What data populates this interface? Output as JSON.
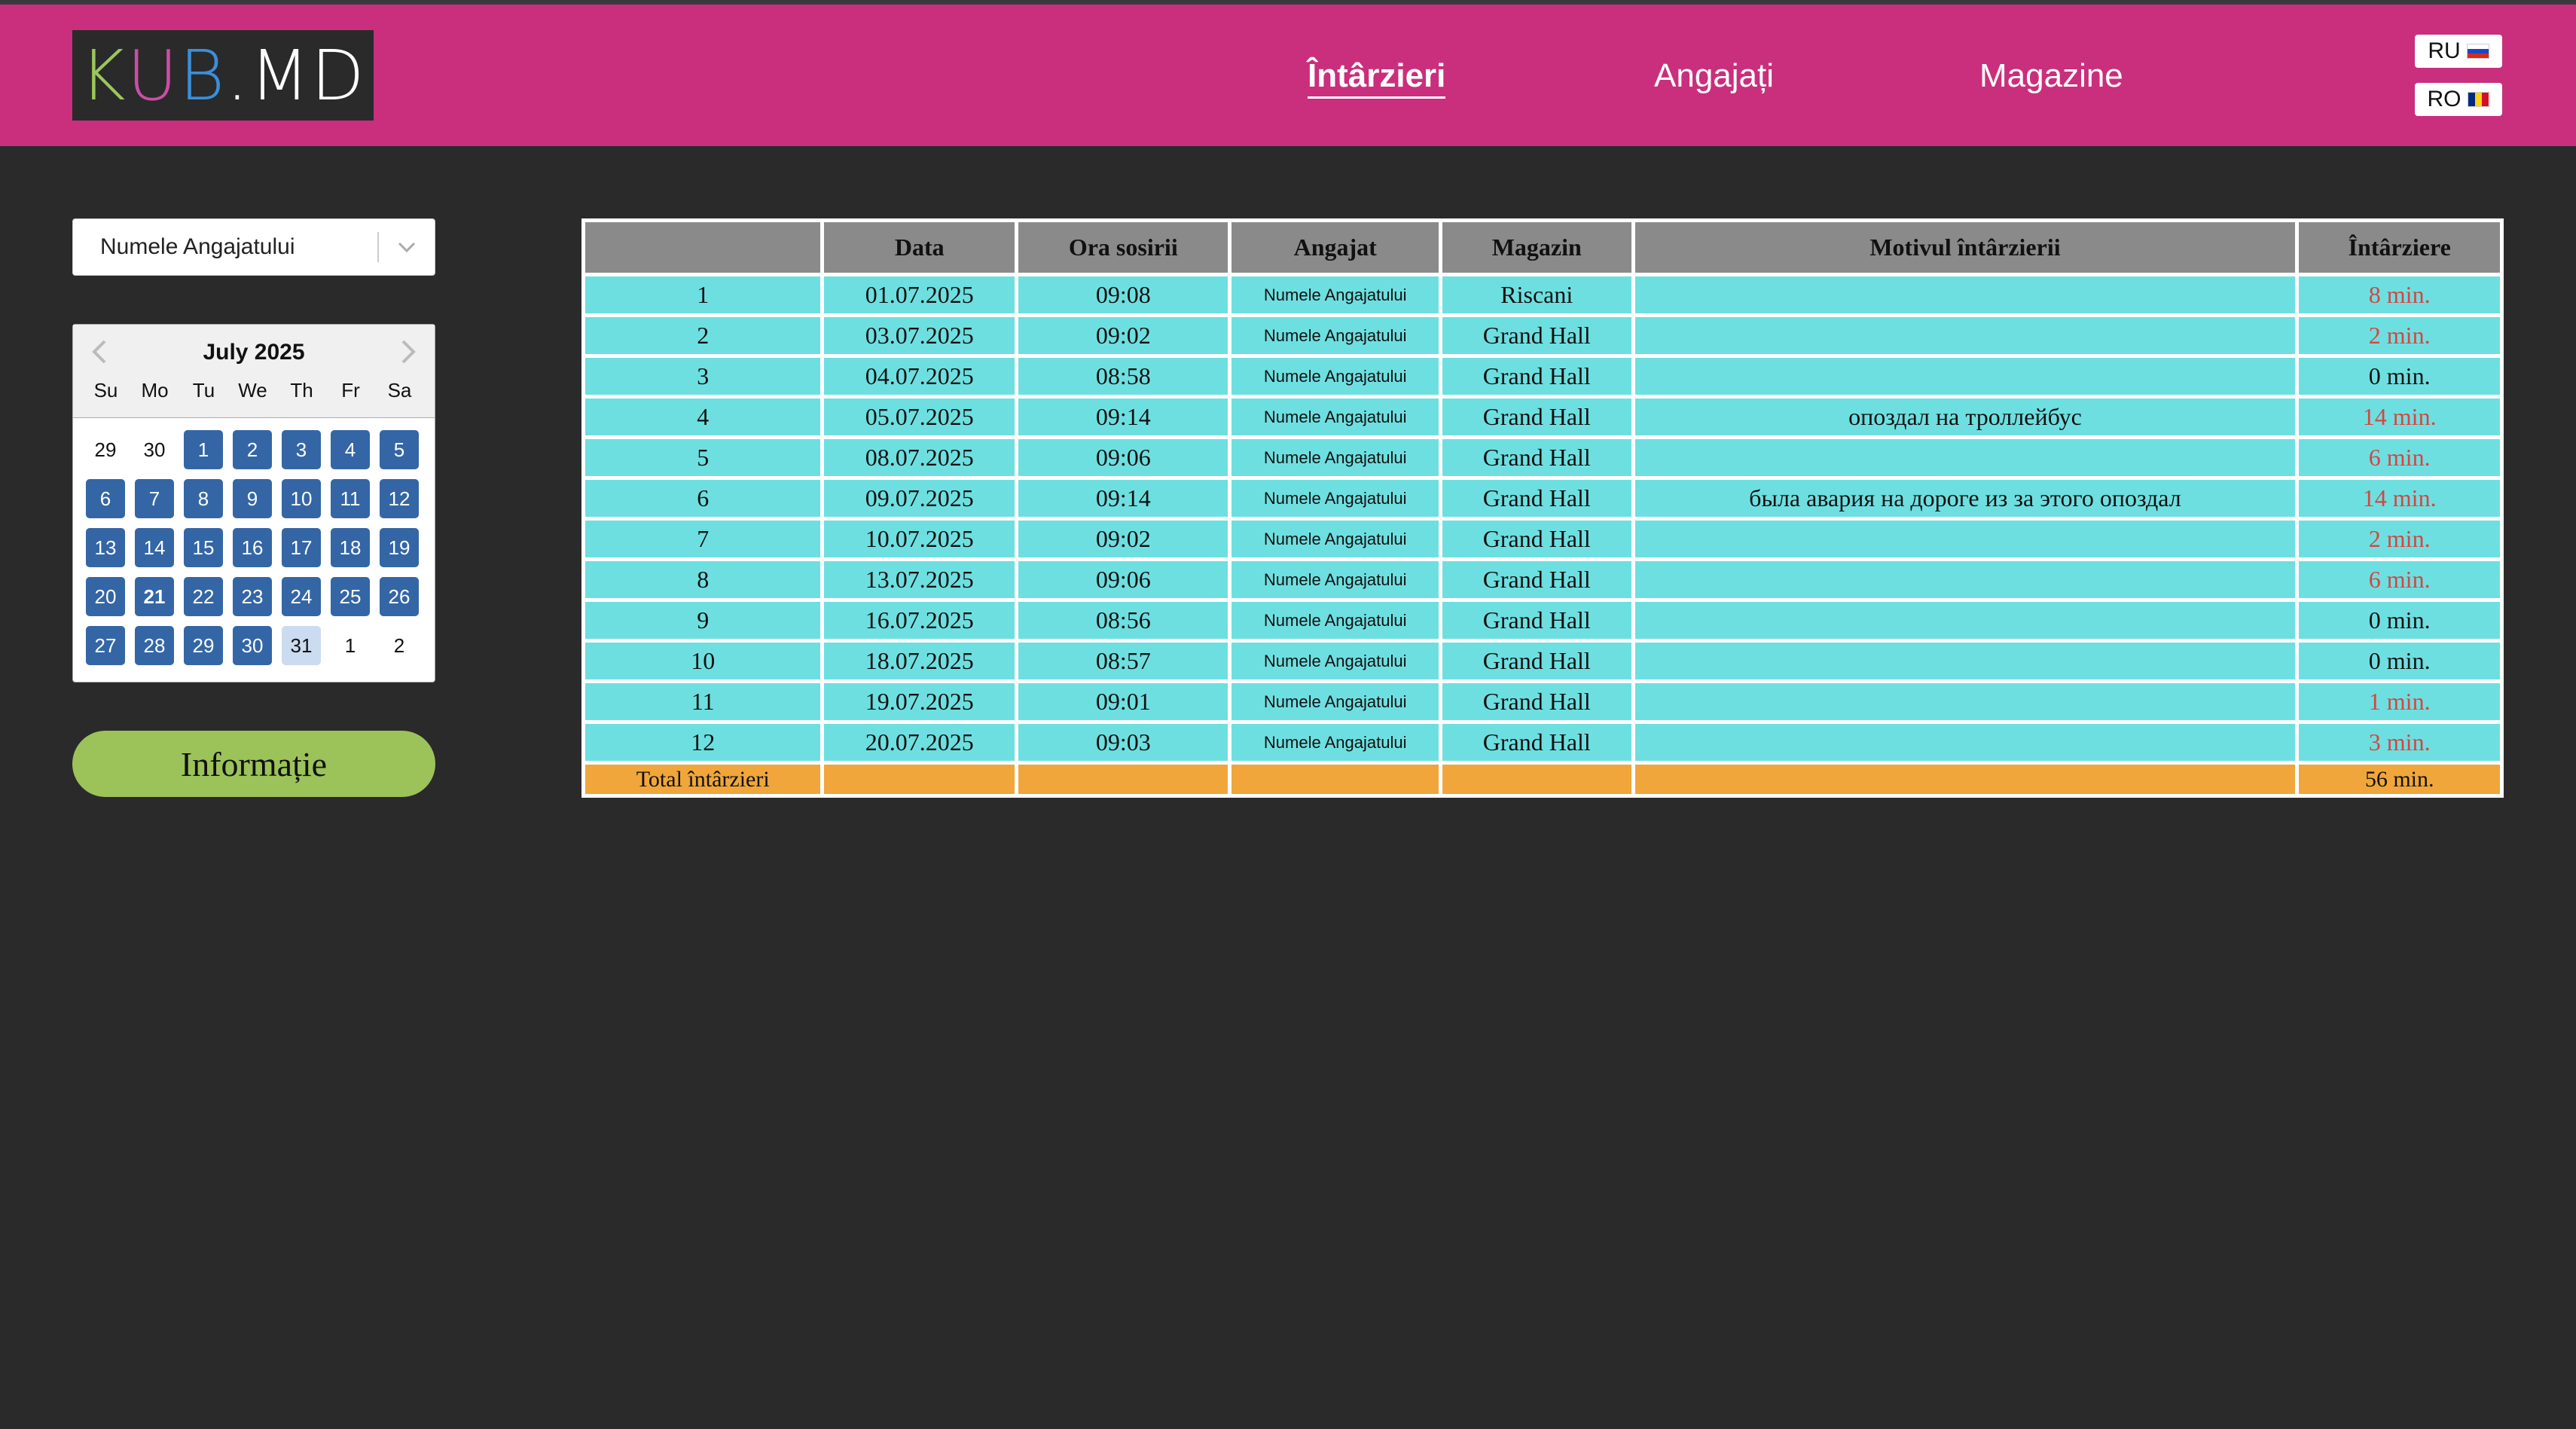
{
  "logo": {
    "letters": [
      "K",
      "U",
      "B",
      ".MD"
    ],
    "colors": [
      "#9bc65c",
      "#c94ea6",
      "#3b8fd9",
      "#ffffff"
    ]
  },
  "nav": [
    {
      "label": "Întârzieri",
      "active": true
    },
    {
      "label": "Angajați",
      "active": false
    },
    {
      "label": "Magazine",
      "active": false
    }
  ],
  "lang": {
    "ru": "RU",
    "ro": "RO"
  },
  "employee_select": {
    "value": "Numele Angajatului"
  },
  "calendar": {
    "title": "July 2025",
    "weekdays": [
      "Su",
      "Mo",
      "Tu",
      "We",
      "Th",
      "Fr",
      "Sa"
    ],
    "days": [
      {
        "d": "29",
        "t": "other"
      },
      {
        "d": "30",
        "t": "other"
      },
      {
        "d": "1",
        "t": "in"
      },
      {
        "d": "2",
        "t": "in"
      },
      {
        "d": "3",
        "t": "in"
      },
      {
        "d": "4",
        "t": "in"
      },
      {
        "d": "5",
        "t": "in"
      },
      {
        "d": "6",
        "t": "in"
      },
      {
        "d": "7",
        "t": "in"
      },
      {
        "d": "8",
        "t": "in"
      },
      {
        "d": "9",
        "t": "in"
      },
      {
        "d": "10",
        "t": "in"
      },
      {
        "d": "11",
        "t": "in"
      },
      {
        "d": "12",
        "t": "in"
      },
      {
        "d": "13",
        "t": "in"
      },
      {
        "d": "14",
        "t": "in"
      },
      {
        "d": "15",
        "t": "in"
      },
      {
        "d": "16",
        "t": "in"
      },
      {
        "d": "17",
        "t": "in"
      },
      {
        "d": "18",
        "t": "in"
      },
      {
        "d": "19",
        "t": "in"
      },
      {
        "d": "20",
        "t": "in"
      },
      {
        "d": "21",
        "t": "today"
      },
      {
        "d": "22",
        "t": "in"
      },
      {
        "d": "23",
        "t": "in"
      },
      {
        "d": "24",
        "t": "in"
      },
      {
        "d": "25",
        "t": "in"
      },
      {
        "d": "26",
        "t": "in"
      },
      {
        "d": "27",
        "t": "in"
      },
      {
        "d": "28",
        "t": "in"
      },
      {
        "d": "29",
        "t": "in"
      },
      {
        "d": "30",
        "t": "in"
      },
      {
        "d": "31",
        "t": "light"
      },
      {
        "d": "1",
        "t": "other"
      },
      {
        "d": "2",
        "t": "other"
      }
    ]
  },
  "info_button": "Informație",
  "table": {
    "headers": [
      "",
      "Data",
      "Ora sosirii",
      "Angajat",
      "Magazin",
      "Motivul întârzierii",
      "Întârziere"
    ],
    "rows": [
      {
        "n": "1",
        "date": "01.07.2025",
        "time": "09:08",
        "emp": "Numele Angajatului",
        "store": "Riscani",
        "reason": "",
        "delay": "8 min.",
        "late": true
      },
      {
        "n": "2",
        "date": "03.07.2025",
        "time": "09:02",
        "emp": "Numele Angajatului",
        "store": "Grand Hall",
        "reason": "",
        "delay": "2 min.",
        "late": true
      },
      {
        "n": "3",
        "date": "04.07.2025",
        "time": "08:58",
        "emp": "Numele Angajatului",
        "store": "Grand Hall",
        "reason": "",
        "delay": "0 min.",
        "late": false
      },
      {
        "n": "4",
        "date": "05.07.2025",
        "time": "09:14",
        "emp": "Numele Angajatului",
        "store": "Grand Hall",
        "reason": "опоздал на троллейбус",
        "delay": "14 min.",
        "late": true
      },
      {
        "n": "5",
        "date": "08.07.2025",
        "time": "09:06",
        "emp": "Numele Angajatului",
        "store": "Grand Hall",
        "reason": "",
        "delay": "6 min.",
        "late": true
      },
      {
        "n": "6",
        "date": "09.07.2025",
        "time": "09:14",
        "emp": "Numele Angajatului",
        "store": "Grand Hall",
        "reason": "была авария на дороге из за этого опоздал",
        "delay": "14 min.",
        "late": true
      },
      {
        "n": "7",
        "date": "10.07.2025",
        "time": "09:02",
        "emp": "Numele Angajatului",
        "store": "Grand Hall",
        "reason": "",
        "delay": "2 min.",
        "late": true
      },
      {
        "n": "8",
        "date": "13.07.2025",
        "time": "09:06",
        "emp": "Numele Angajatului",
        "store": "Grand Hall",
        "reason": "",
        "delay": "6 min.",
        "late": true
      },
      {
        "n": "9",
        "date": "16.07.2025",
        "time": "08:56",
        "emp": "Numele Angajatului",
        "store": "Grand Hall",
        "reason": "",
        "delay": "0 min.",
        "late": false
      },
      {
        "n": "10",
        "date": "18.07.2025",
        "time": "08:57",
        "emp": "Numele Angajatului",
        "store": "Grand Hall",
        "reason": "",
        "delay": "0 min.",
        "late": false
      },
      {
        "n": "11",
        "date": "19.07.2025",
        "time": "09:01",
        "emp": "Numele Angajatului",
        "store": "Grand Hall",
        "reason": "",
        "delay": "1 min.",
        "late": true
      },
      {
        "n": "12",
        "date": "20.07.2025",
        "time": "09:03",
        "emp": "Numele Angajatului",
        "store": "Grand Hall",
        "reason": "",
        "delay": "3 min.",
        "late": true
      }
    ],
    "total_label": "Total întârzieri",
    "total_value": "56 min."
  },
  "colors": {
    "header": "#c92f7d",
    "cell": "#6edfe0",
    "late": "#d64541",
    "total": "#f0a63b",
    "button": "#9cc25a",
    "day": "#3466a6"
  }
}
